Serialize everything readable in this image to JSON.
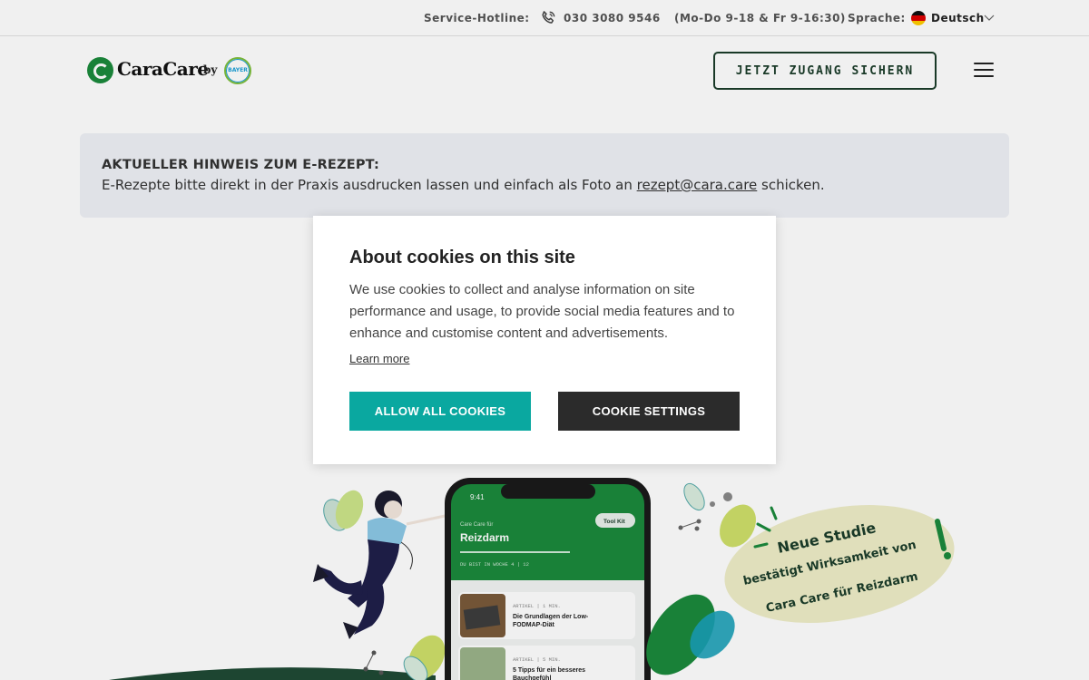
{
  "topbar": {
    "hotline_label": "Service-Hotline:",
    "phone_number": "030 3080 9546",
    "hours": "(Mo-Do 9-18 & Fr 9-16:30)",
    "language_label": "Sprache:",
    "language_value": "Deutsch",
    "icons": [
      "phone-icon",
      "german-flag-icon",
      "chevron-down-icon"
    ]
  },
  "header": {
    "logo_text": "CaraCare",
    "logo_by": "by",
    "partner_logo": "BAYER",
    "cta_label": "JETZT ZUGANG SICHERN",
    "menu_icon": "hamburger-menu-icon"
  },
  "notice": {
    "title": "AKTUELLER HINWEIS ZUM E-REZEPT:",
    "text_before": "E-Rezepte bitte direkt in der Praxis ausdrucken lassen und einfach als Foto an ",
    "link": "rezept@cara.care",
    "text_after": " schicken."
  },
  "hero": {
    "phone": {
      "time": "9:41",
      "subtitle": "Care Care für",
      "title": "Reizdarm",
      "toolkit": "Tool Kit",
      "week": "DU BIST IN WOCHE  4 | 12",
      "cards": [
        {
          "meta": "ARTIKEL | 1 MIN.",
          "title": "Die Grundlagen der Low-FODMAP-Diät"
        },
        {
          "meta": "ARTIKEL | 5 MIN.",
          "title": "5 Tipps für ein besseres Bauchgefühl"
        }
      ]
    },
    "badge_lines": [
      "Neue Studie",
      "bestätigt Wirksamkeit von",
      "Cara Care für Reizdarm"
    ],
    "colors": {
      "green": "#1b8a3c",
      "light_green": "#c7d97a",
      "teal": "#1aa0b8",
      "badge": "#eeedc7"
    }
  },
  "cookie_modal": {
    "title": "About cookies on this site",
    "body": "We use cookies to collect and analyse information on site performance and usage, to provide social media features and to enhance and customise content and advertisements.",
    "learn_more": "Learn more",
    "allow_label": "ALLOW ALL COOKIES",
    "settings_label": "COOKIE SETTINGS",
    "colors": {
      "allow": "#0aa8a0",
      "settings": "#2b2b2b"
    }
  }
}
